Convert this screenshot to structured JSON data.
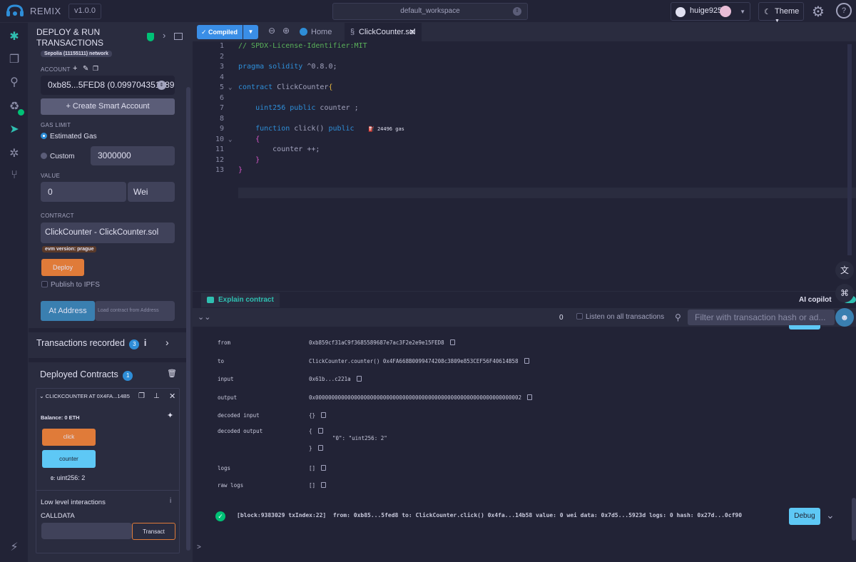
{
  "topbar": {
    "brand": "REMIX",
    "version": "v1.0.0",
    "workspace": "default_workspace",
    "username": "huige925",
    "theme_label": "Theme"
  },
  "iconbar": {
    "items": [
      "remix-logo-icon",
      "file-explorer-icon",
      "search-icon",
      "solidity-compiler-icon",
      "deploy-run-icon",
      "debugger-icon",
      "git-icon",
      "plugin-manager-icon"
    ]
  },
  "sidepanel": {
    "title": "DEPLOY & RUN TRANSACTIONS",
    "network": "Sepolia (11155111) network",
    "account_label": "ACCOUNT",
    "account_value": "0xb85...5FED8 (0.0997043514896",
    "create_smart_account": "+ Create Smart Account",
    "gas_limit_label": "GAS LIMIT",
    "estimated_gas": "Estimated Gas",
    "custom": "Custom",
    "gas_value": "3000000",
    "value_label": "VALUE",
    "value_amount": "0",
    "value_unit": "Wei",
    "contract_label": "CONTRACT",
    "contract_value": "ClickCounter - ClickCounter.sol",
    "evm_version": "evm version: prague",
    "deploy": "Deploy",
    "publish_ipfs": "Publish to IPFS",
    "at_address": "At Address",
    "at_address_placeholder": "Load contract from Address",
    "transactions_recorded": "Transactions recorded",
    "transactions_count": "3",
    "deployed_contracts": "Deployed Contracts",
    "deployed_count": "1",
    "instance_name": "CLICKCOUNTER AT 0X4FA...14B5",
    "balance": "Balance: 0 ETH",
    "click": "click",
    "counter": "counter",
    "counter_result_key": "0:",
    "counter_result_val": "uint256: 2",
    "low_level": "Low level interactions",
    "calldata": "CALLDATA",
    "transact": "Transact"
  },
  "editor": {
    "compiled": "Compiled",
    "home_tab": "Home",
    "file_tab": "ClickCounter.sol",
    "gas_hint": "24496 gas",
    "lines": [
      {
        "n": "1",
        "t": "// SPDX-License-Identifier:MIT"
      },
      {
        "n": "2",
        "t": ""
      },
      {
        "n": "3",
        "t": "pragma solidity ^0.8.0;"
      },
      {
        "n": "4",
        "t": ""
      },
      {
        "n": "5",
        "t": "contract ClickCounter{"
      },
      {
        "n": "6",
        "t": ""
      },
      {
        "n": "7",
        "t": "    uint256 public counter ;"
      },
      {
        "n": "8",
        "t": ""
      },
      {
        "n": "9",
        "t": "    function click() public"
      },
      {
        "n": "10",
        "t": "    {"
      },
      {
        "n": "11",
        "t": "        counter ++;"
      },
      {
        "n": "12",
        "t": "    }"
      },
      {
        "n": "13",
        "t": "}"
      }
    ]
  },
  "terminal": {
    "explain": "Explain contract",
    "copilot": "AI copilot",
    "count": "0",
    "listen": "Listen on all transactions",
    "filter_placeholder": "Filter with transaction hash or ad...",
    "rows": [
      {
        "k": "from",
        "v": "0xb859cf31aC9f3685589687e7ac3F2e2e9e15FED8"
      },
      {
        "k": "to",
        "v": "ClickCounter.counter() 0x4FA668B0099474208c3809e853CEF56F40614B58"
      },
      {
        "k": "input",
        "v": "0x61b...c221a"
      },
      {
        "k": "output",
        "v": "0x0000000000000000000000000000000000000000000000000000000000000002"
      },
      {
        "k": "decoded input",
        "v": "{}"
      },
      {
        "k": "decoded output",
        "v": "{"
      },
      {
        "k": "logs",
        "v": "[]"
      },
      {
        "k": "raw logs",
        "v": "[]"
      }
    ],
    "decoded_output_inner": "\"0\": \"uint256: 2\"",
    "decoded_output_close": "}",
    "tx_summary": "[block:9383029 txIndex:22]  from: 0xb85...5fed8 to: ClickCounter.click() 0x4fa...14b58 value: 0 wei data: 0x7d5...5923d logs: 0 hash: 0x27d...0cf90",
    "debug": "Debug",
    "prompt": ">"
  }
}
